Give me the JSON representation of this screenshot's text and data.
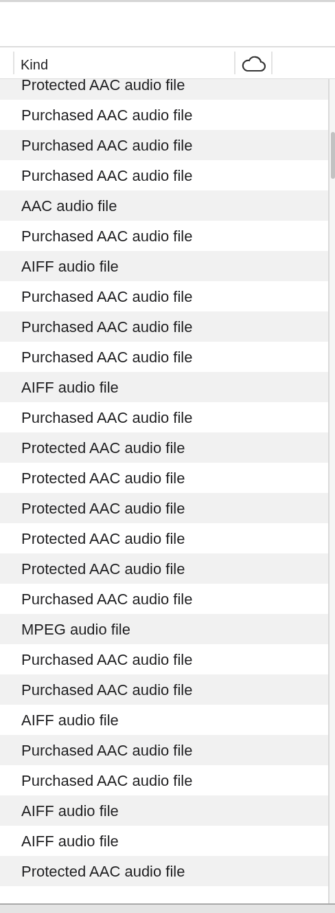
{
  "table": {
    "columns": [
      {
        "label": "Kind"
      }
    ],
    "rows": [
      {
        "file_kind": "Protected AAC audio file"
      },
      {
        "file_kind": "Purchased AAC audio file"
      },
      {
        "file_kind": "Purchased AAC audio file"
      },
      {
        "file_kind": "Purchased AAC audio file"
      },
      {
        "file_kind": "AAC audio file"
      },
      {
        "file_kind": "Purchased AAC audio file"
      },
      {
        "file_kind": "AIFF audio file"
      },
      {
        "file_kind": "Purchased AAC audio file"
      },
      {
        "file_kind": "Purchased AAC audio file"
      },
      {
        "file_kind": "Purchased AAC audio file"
      },
      {
        "file_kind": "AIFF audio file"
      },
      {
        "file_kind": "Purchased AAC audio file"
      },
      {
        "file_kind": "Protected AAC audio file"
      },
      {
        "file_kind": "Protected AAC audio file"
      },
      {
        "file_kind": "Protected AAC audio file"
      },
      {
        "file_kind": "Protected AAC audio file"
      },
      {
        "file_kind": "Protected AAC audio file"
      },
      {
        "file_kind": "Purchased AAC audio file"
      },
      {
        "file_kind": "MPEG audio file"
      },
      {
        "file_kind": "Purchased AAC audio file"
      },
      {
        "file_kind": "Purchased AAC audio file"
      },
      {
        "file_kind": "AIFF audio file"
      },
      {
        "file_kind": "Purchased AAC audio file"
      },
      {
        "file_kind": "Purchased AAC audio file"
      },
      {
        "file_kind": "AIFF audio file"
      },
      {
        "file_kind": "AIFF audio file"
      },
      {
        "file_kind": "Protected AAC audio file"
      }
    ]
  }
}
